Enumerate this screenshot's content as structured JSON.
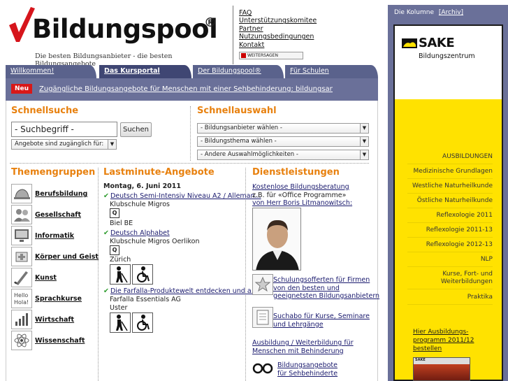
{
  "header": {
    "logo_text": "Bildungspool",
    "logo_reg": "®",
    "tagline": "Die besten Bildungsanbieter - die besten Bildungsangebote",
    "links": [
      "FAQ",
      "Unterstützungskomitee",
      "Partner",
      "Nutzungsbedingungen",
      "Kontakt"
    ],
    "share_label": "WEITERSAGEN"
  },
  "tabs": [
    "Willkommen!",
    "Das Kursportal",
    "Der Bildungspool®",
    "Für Schulen"
  ],
  "news": {
    "badge": "Neu",
    "text": "Zugängliche Bildungsangebote für Menschen mit einer Sehbehinderung: bildungsangebote-fuer-"
  },
  "schnellsuche": {
    "title": "Schnellsuche",
    "input_value": "- Suchbegriff -",
    "button": "Suchen",
    "select_access": "Angebote sind zugänglich für:"
  },
  "schnellauswahl": {
    "title": "Schnellauswahl",
    "selects": [
      "- Bildungsanbieter wählen -",
      "- Bildungsthema wählen -",
      "- Andere Auswahlmöglichkeiten -"
    ]
  },
  "themengruppen": {
    "title": "Themengruppen",
    "items": [
      "Berufsbildung",
      "Gesellschaft",
      "Informatik",
      "Körper und Geist",
      "Kunst",
      "Sprachkurse",
      "Wirtschaft",
      "Wissenschaft"
    ]
  },
  "lastminute": {
    "title": "Lastminute-Angebote",
    "date": "Montag, 6. Juni 2011",
    "offers": [
      {
        "title": "Deutsch Semi-Intensiv Niveau A2 / Alleman...",
        "provider": "Klubschule Migros",
        "badge": "Q",
        "place": "Biel BE"
      },
      {
        "title": "Deutsch Alphabet",
        "provider": "Klubschule Migros Oerlikon",
        "badge": "Q",
        "place": "Zürich"
      },
      {
        "title": "Die Farfalla-Produktewelt entdecken und a...",
        "provider": "Farfalla Essentials AG",
        "place": "Uster"
      }
    ]
  },
  "dienstleistungen": {
    "title": "Dienstleistungen",
    "beratung": [
      "Kostenlose Bildungsberatung",
      "z.B. für «Office Programme»",
      "von Herr Boris Litmanowitsch:"
    ],
    "schulung": [
      "Schulungsofferten für Firmen",
      "von den besten und",
      "geeignetsten Bildungsanbietern"
    ],
    "suchabo": [
      "Suchabo für Kurse, Seminare",
      "und Lehrgänge"
    ],
    "behinderung": [
      "Ausbildung / Weiterbildung für",
      "Menschen mit Behinderung"
    ],
    "sehbehinderte": [
      "Bildungsangebote",
      "für Sehbehinderte"
    ]
  },
  "kolumne": {
    "label": "Die Kolumne",
    "archiv": "[Archiv]",
    "ad": {
      "brand": "SAKE",
      "sub": "Bildungszentrum",
      "items": [
        "AUSBILDUNGEN",
        "Medizinische Grundlagen",
        "Westliche Naturheilkunde",
        "Östliche Naturheilkunde",
        "Reflexologie 2011",
        "Reflexologie 2011-13",
        "Reflexologie 2012-13",
        "NLP",
        "Kurse, Fort- und Weiterbildungen",
        "Praktika"
      ],
      "link": "Hier Ausbildungs-programm 2011/12 bestellen",
      "thumb": "SAKE"
    }
  },
  "colors": {
    "accent": "#e8810f",
    "nav": "#5a628c",
    "badge": "#d81818",
    "ad_bg": "#ffe200"
  }
}
